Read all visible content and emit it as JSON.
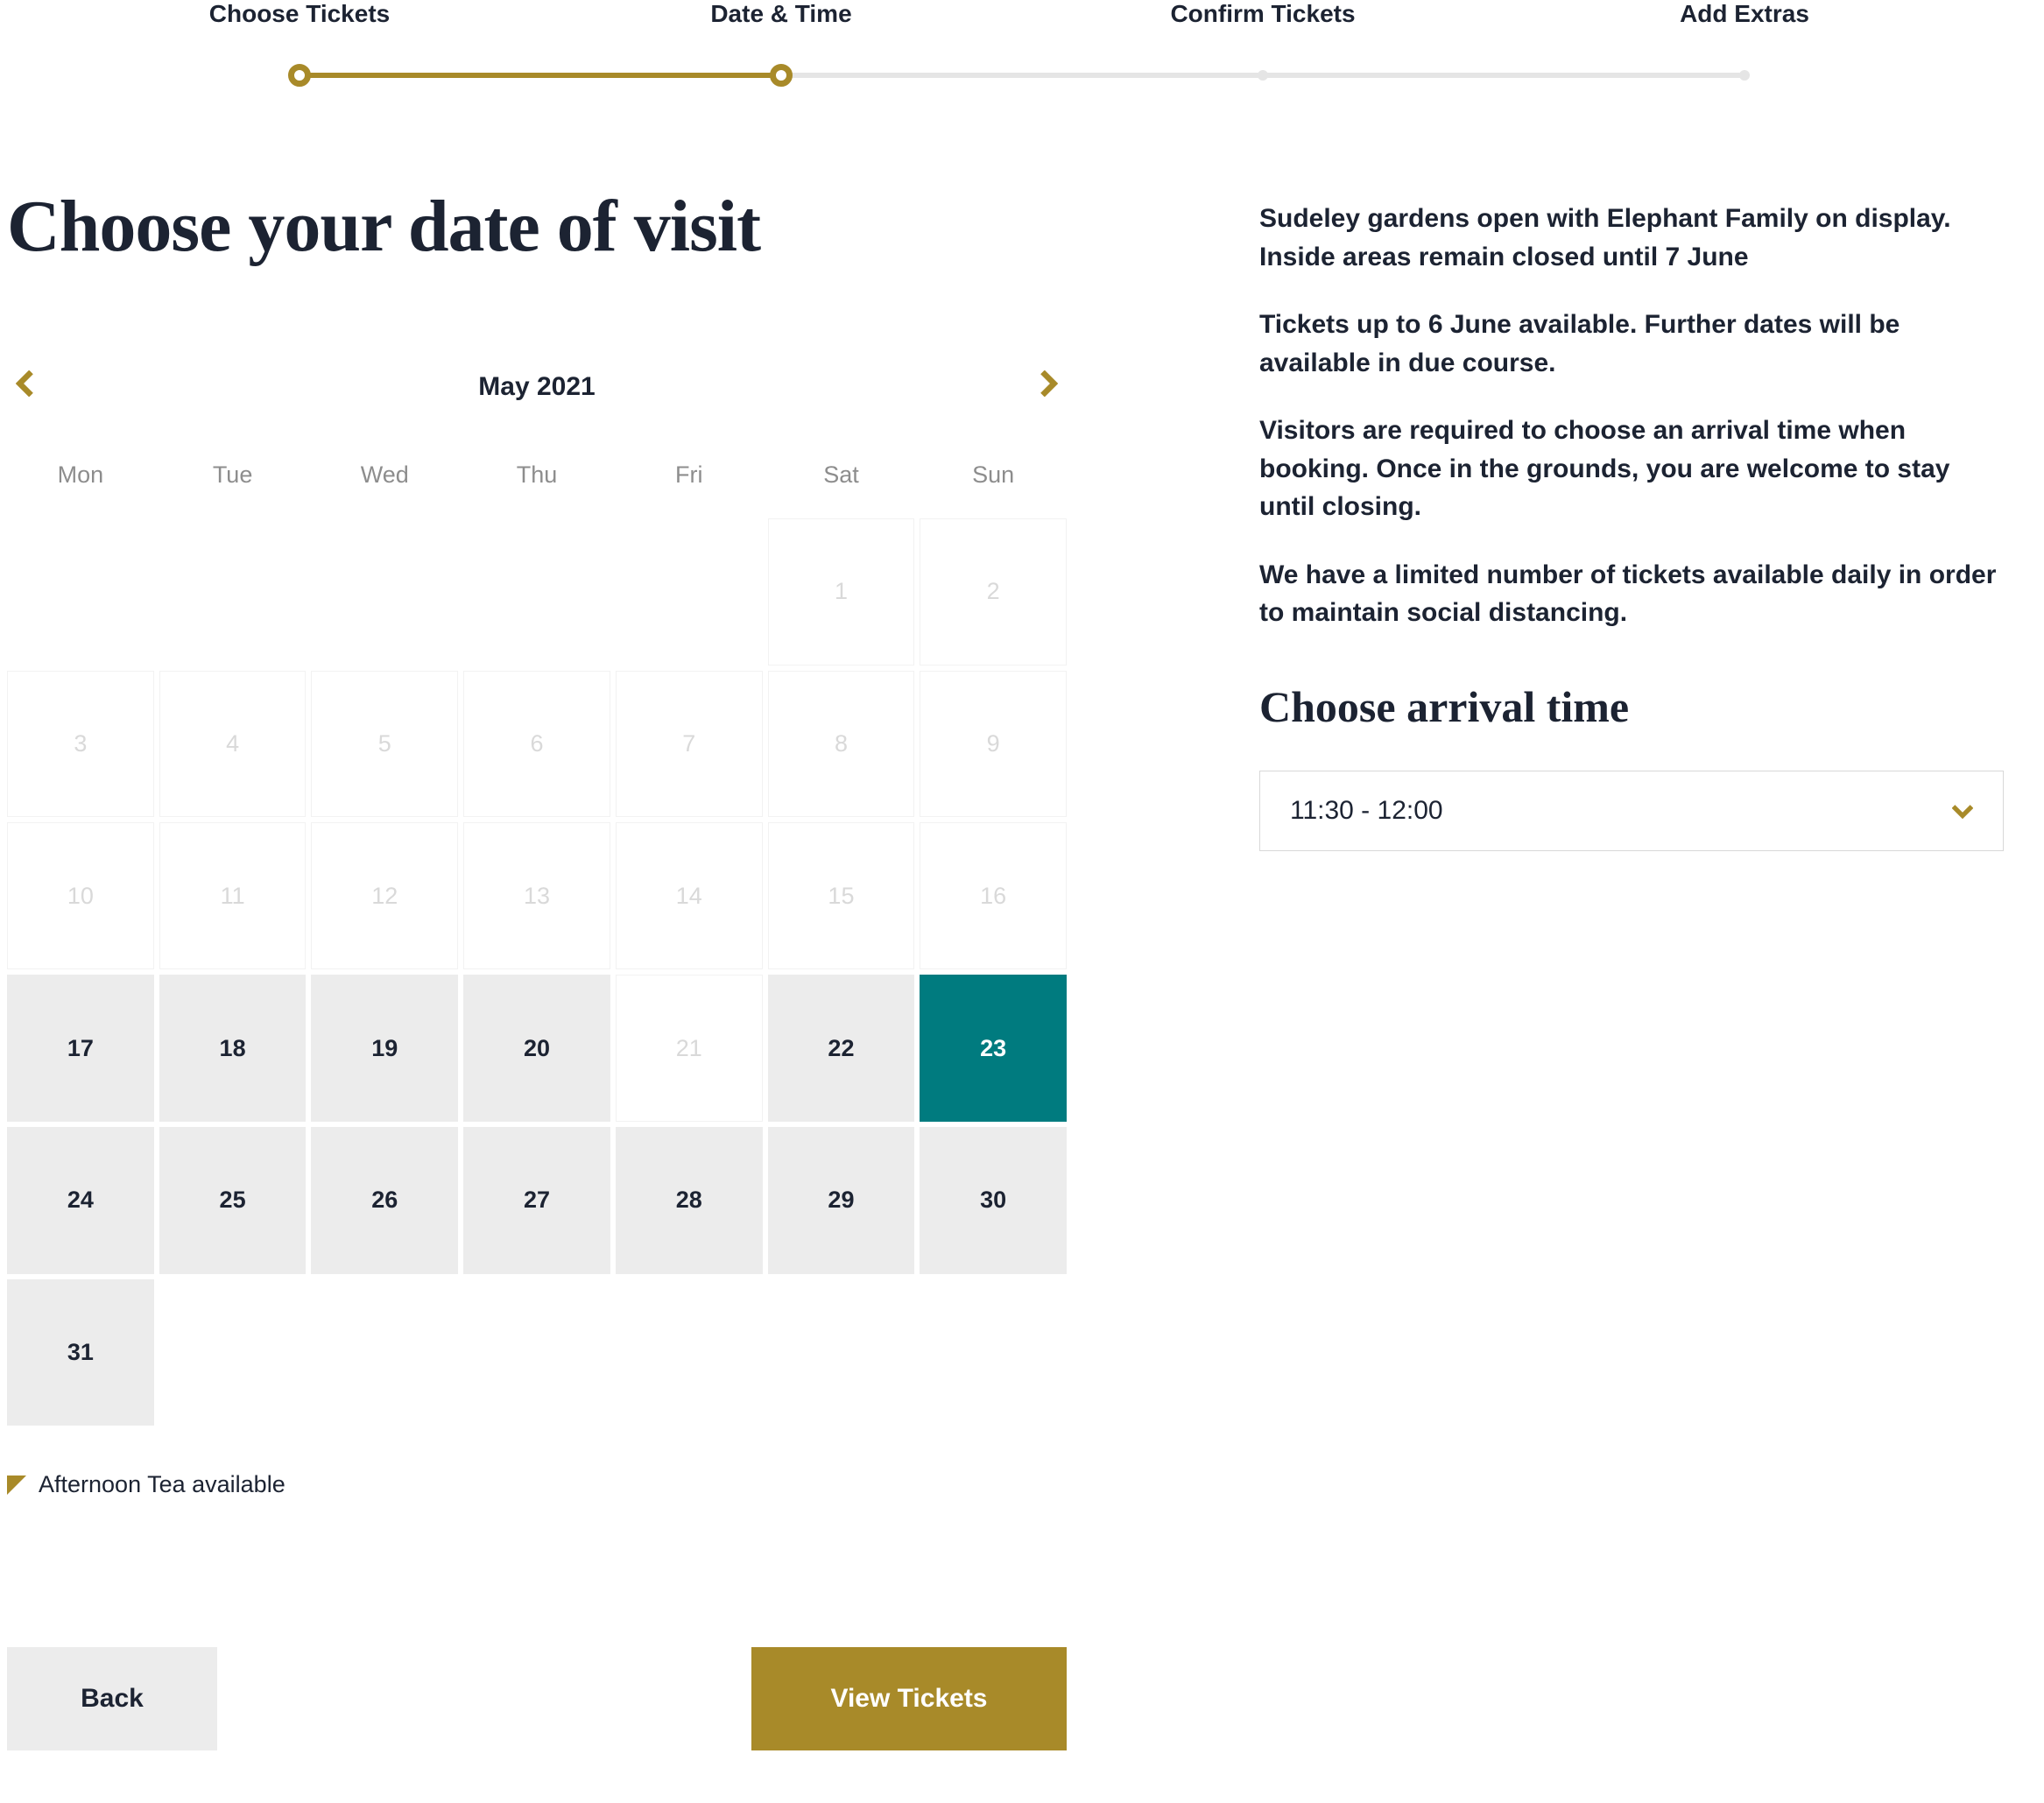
{
  "steps": [
    "Choose Tickets",
    "Date & Time",
    "Confirm Tickets",
    "Add Extras"
  ],
  "current_step_index": 1,
  "page_title": "Choose your date of visit",
  "calendar": {
    "month_label": "May 2021",
    "dow": [
      "Mon",
      "Tue",
      "Wed",
      "Thu",
      "Fri",
      "Sat",
      "Sun"
    ],
    "cells": [
      {
        "t": "blank"
      },
      {
        "t": "blank"
      },
      {
        "t": "blank"
      },
      {
        "t": "blank"
      },
      {
        "t": "blank"
      },
      {
        "t": "disabled",
        "n": "1"
      },
      {
        "t": "disabled",
        "n": "2"
      },
      {
        "t": "disabled",
        "n": "3"
      },
      {
        "t": "disabled",
        "n": "4"
      },
      {
        "t": "disabled",
        "n": "5"
      },
      {
        "t": "disabled",
        "n": "6"
      },
      {
        "t": "disabled",
        "n": "7"
      },
      {
        "t": "disabled",
        "n": "8"
      },
      {
        "t": "disabled",
        "n": "9"
      },
      {
        "t": "disabled",
        "n": "10"
      },
      {
        "t": "disabled",
        "n": "11"
      },
      {
        "t": "disabled",
        "n": "12"
      },
      {
        "t": "disabled",
        "n": "13"
      },
      {
        "t": "disabled",
        "n": "14"
      },
      {
        "t": "disabled",
        "n": "15"
      },
      {
        "t": "disabled",
        "n": "16"
      },
      {
        "t": "available",
        "n": "17"
      },
      {
        "t": "available",
        "n": "18"
      },
      {
        "t": "available",
        "n": "19"
      },
      {
        "t": "available",
        "n": "20"
      },
      {
        "t": "unavailable-mid",
        "n": "21"
      },
      {
        "t": "available",
        "n": "22"
      },
      {
        "t": "selected",
        "n": "23"
      },
      {
        "t": "available",
        "n": "24"
      },
      {
        "t": "available",
        "n": "25"
      },
      {
        "t": "available",
        "n": "26"
      },
      {
        "t": "available",
        "n": "27"
      },
      {
        "t": "available",
        "n": "28"
      },
      {
        "t": "available",
        "n": "29"
      },
      {
        "t": "available",
        "n": "30"
      },
      {
        "t": "available",
        "n": "31"
      }
    ]
  },
  "legend": "Afternoon Tea available",
  "info_paragraphs": [
    "Sudeley gardens open with Elephant Family on display. Inside areas remain closed until 7 June",
    "Tickets up to 6 June available. Further dates will be available in due course.",
    "Visitors are required to choose an arrival time when booking. Once in the grounds, you are welcome to stay until closing.",
    "We have a limited number of tickets available daily in order to maintain social distancing."
  ],
  "arrival_heading": "Choose arrival time",
  "arrival_selected": "11:30 - 12:00",
  "buttons": {
    "back": "Back",
    "next": "View Tickets"
  }
}
